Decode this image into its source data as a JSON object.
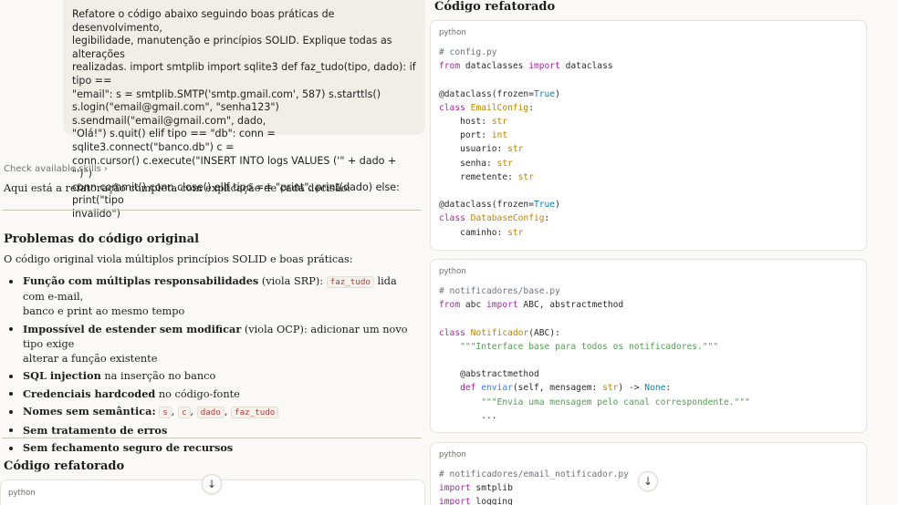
{
  "user_message": {
    "lines": [
      "Refatore o código abaixo seguindo boas práticas de desenvolvimento,",
      "legibilidade, manutenção e princípios SOLID. Explique todas as alterações",
      "realizadas. import smtplib import sqlite3 def faz_tudo(tipo, dado): if tipo ==",
      "\"email\": s = smtplib.SMTP('smtp.gmail.com', 587) s.starttls()",
      "s.login(\"email@gmail.com\", \"senha123\") s.sendmail(\"email@gmail.com\", dado,",
      "\"Olá!\") s.quit() elif tipo == \"db\": conn = sqlite3.connect(\"banco.db\") c =",
      "conn.cursor() c.execute(\"INSERT INTO logs VALUES ('\" + dado + \"')\")",
      "conn.commit() conn.close() elif tipo == \"print\": print(dado) else: print(\"tipo",
      "invalido\")"
    ]
  },
  "skills_link": "Check available skills",
  "skills_chevron": "›",
  "intro": "Aqui está a refatoração completa com explicação de cada decisão:",
  "section1_title": "Problemas do código original",
  "section1_intro": "O código original viola múltiplos princípios SOLID e boas práticas:",
  "issues": {
    "i1_bold": "Função com múltiplas responsabilidades",
    "i1_rest1": " (viola SRP): ",
    "i1_code": "faz_tudo",
    "i1_rest2": " lida com e-mail,",
    "i1_rest3": "banco e print ao mesmo tempo",
    "i2_bold": "Impossível de estender sem modificar",
    "i2_rest1": " (viola OCP): adicionar um novo tipo exige",
    "i2_rest2": "alterar a função existente",
    "i3_bold": "SQL injection",
    "i3_rest": " na inserção no banco",
    "i4_bold": "Credenciais hardcoded",
    "i4_rest": " no código-fonte",
    "i5_bold": "Nomes sem semântica:",
    "i5_c1": "s",
    "i5_c2": "c",
    "i5_c3": "dado",
    "i5_c4": "faz_tudo",
    "i6_bold": "Sem tratamento de erros",
    "i7_bold": "Sem fechamento seguro de recursos"
  },
  "section2_title": "Código refatorado",
  "bottom_card_lang": "python",
  "scroll_down": "↓",
  "right_title": "Código refatorado",
  "card1": {
    "lang": "python",
    "c_comment": "# config.py",
    "c_from": "from",
    "c_mod": " dataclasses ",
    "c_import": "import",
    "c_name": " dataclass",
    "c_dec1": "@dataclass(frozen=",
    "c_true1": "True",
    "c_dec1_end": ")",
    "c_class1": "class",
    "c_cls1": "EmailConfig",
    "f1": "host",
    "f2": "port",
    "f3": "usuario",
    "f4": "senha",
    "f5": "remetente",
    "t_str": "str",
    "t_int": "int",
    "c_dec2": "@dataclass(frozen=",
    "c_true2": "True",
    "c_dec2_end": ")",
    "c_class2": "class",
    "c_cls2": "DatabaseConfig",
    "f6": "caminho"
  },
  "card2": {
    "lang": "python",
    "comment": "# notificadores/base.py",
    "from": "from",
    "mod": " abc ",
    "import": "import",
    "names": " ABC, abstractmethod",
    "class": "class",
    "cls": "Notificador",
    "base": "(ABC):",
    "doc1": "\"\"\"Interface base para todos os notificadores.\"\"\"",
    "deco": "@abstractmethod",
    "def": "def",
    "fn": "enviar",
    "args": "(self, mensagem: ",
    "ty": "str",
    "arrow": ") -> ",
    "none": "None",
    "colon": ":",
    "doc2": "\"\"\"Envia uma mensagem pelo canal correspondente.\"\"\"",
    "ellipsis": "..."
  },
  "card3": {
    "lang": "python",
    "comment": "# notificadores/email_notificador.py",
    "import1": "import",
    "mod1": " smtplib",
    "import2": "import",
    "mod2": " logging"
  }
}
